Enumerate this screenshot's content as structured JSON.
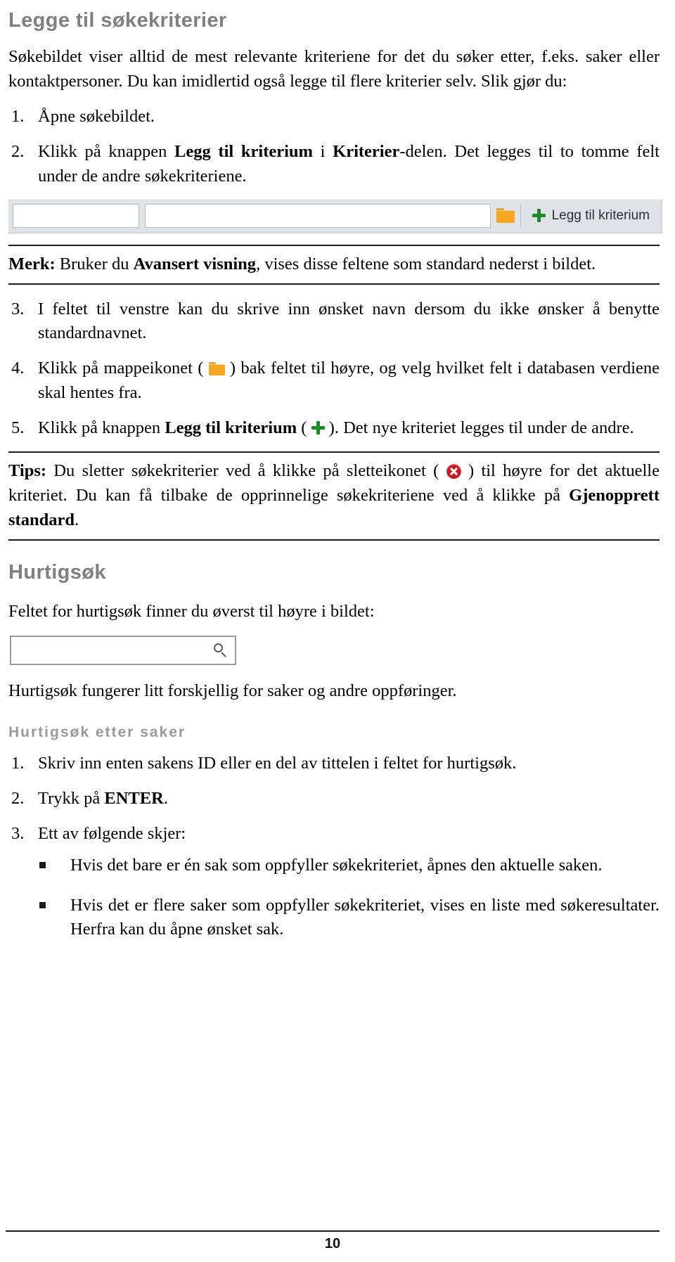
{
  "section1": {
    "heading": "Legge til søkekriterier",
    "intro": {
      "part1": "Søkebildet viser alltid de mest relevante kriteriene for det du søker etter, f.eks. saker eller kontaktpersoner. Du kan imidlertid også legge til flere kriterier selv. Slik gjør du:"
    },
    "steps": [
      {
        "num": "1.",
        "text_before": "Åpne søkebildet.",
        "bold": "",
        "text_after": ""
      },
      {
        "num": "2.",
        "t1": "Klikk på knappen ",
        "b1": "Legg til kriterium",
        "t2": " i ",
        "b2": "Kriterier",
        "t3": "-delen. Det legges til to tomme felt under de andre søkekriteriene."
      },
      {
        "num": "3.",
        "text": "I feltet til venstre kan du skrive inn ønsket navn dersom du ikke ønsker å benytte standardnavnet."
      },
      {
        "num": "4.",
        "t1": "Klikk på mappeikonet ( ",
        "t2": " ) bak feltet til høyre, og velg hvilket felt i databasen verdiene skal hentes fra."
      },
      {
        "num": "5.",
        "t1": "Klikk på knappen ",
        "b1": "Legg til kriterium",
        "t2": " ( ",
        "t3": " ). Det nye kriteriet legges til under de andre."
      }
    ],
    "note": {
      "label": "Merk:",
      "t1": " Bruker du ",
      "b1": "Avansert visning",
      "t2": ", vises disse feltene som standard nederst i bildet."
    },
    "tip": {
      "label": "Tips:",
      "t1": " Du sletter søkekriterier ved å klikke på sletteikonet ( ",
      "t2": " ) til høyre for det aktuelle kriteriet. Du kan få tilbake de opprinnelige søkekriteriene ved å klikke på ",
      "b1": "Gjenopprett standard",
      "t3": "."
    },
    "criteria_widget": {
      "name_field_value": "",
      "name_field_placeholder": "",
      "value_field_value": "",
      "value_field_placeholder": "",
      "folder_icon": "folder-icon",
      "plus_icon": "plus-icon",
      "add_button_label": "Legg til kriterium"
    }
  },
  "section2": {
    "heading": "Hurtigsøk",
    "lead": "Feltet for hurtigsøk finner du øverst til høyre i bildet:",
    "quick_search": {
      "value": "",
      "placeholder": "",
      "icon": "magnifier-icon"
    },
    "after": "Hurtigsøk fungerer litt forskjellig for saker og andre oppføringer.",
    "subheading": "Hurtigsøk etter saker",
    "steps": [
      {
        "num": "1.",
        "text": "Skriv inn enten sakens ID eller en del av tittelen i feltet for hurtigsøk."
      },
      {
        "num": "2.",
        "t1": "Trykk på ",
        "b1": "ENTER",
        "t2": "."
      },
      {
        "num": "3.",
        "text": "Ett av følgende skjer:"
      }
    ],
    "bullets": [
      "Hvis det bare er én sak som oppfyller søkekriteriet, åpnes den aktuelle saken.",
      "Hvis det er flere saker som oppfyller søkekriteriet, vises en liste med søkeresultater. Herfra kan du åpne ønsket sak."
    ]
  },
  "footer": {
    "page_number": "10"
  },
  "colors": {
    "heading_gray": "#808080",
    "subheading_gray": "#9a9a9a",
    "folder_orange": "#f5a623",
    "plus_green": "#1e8a2a",
    "delete_red": "#c81d26",
    "toolbar_bg": "#dfe3e8",
    "body_text": "#000000"
  }
}
